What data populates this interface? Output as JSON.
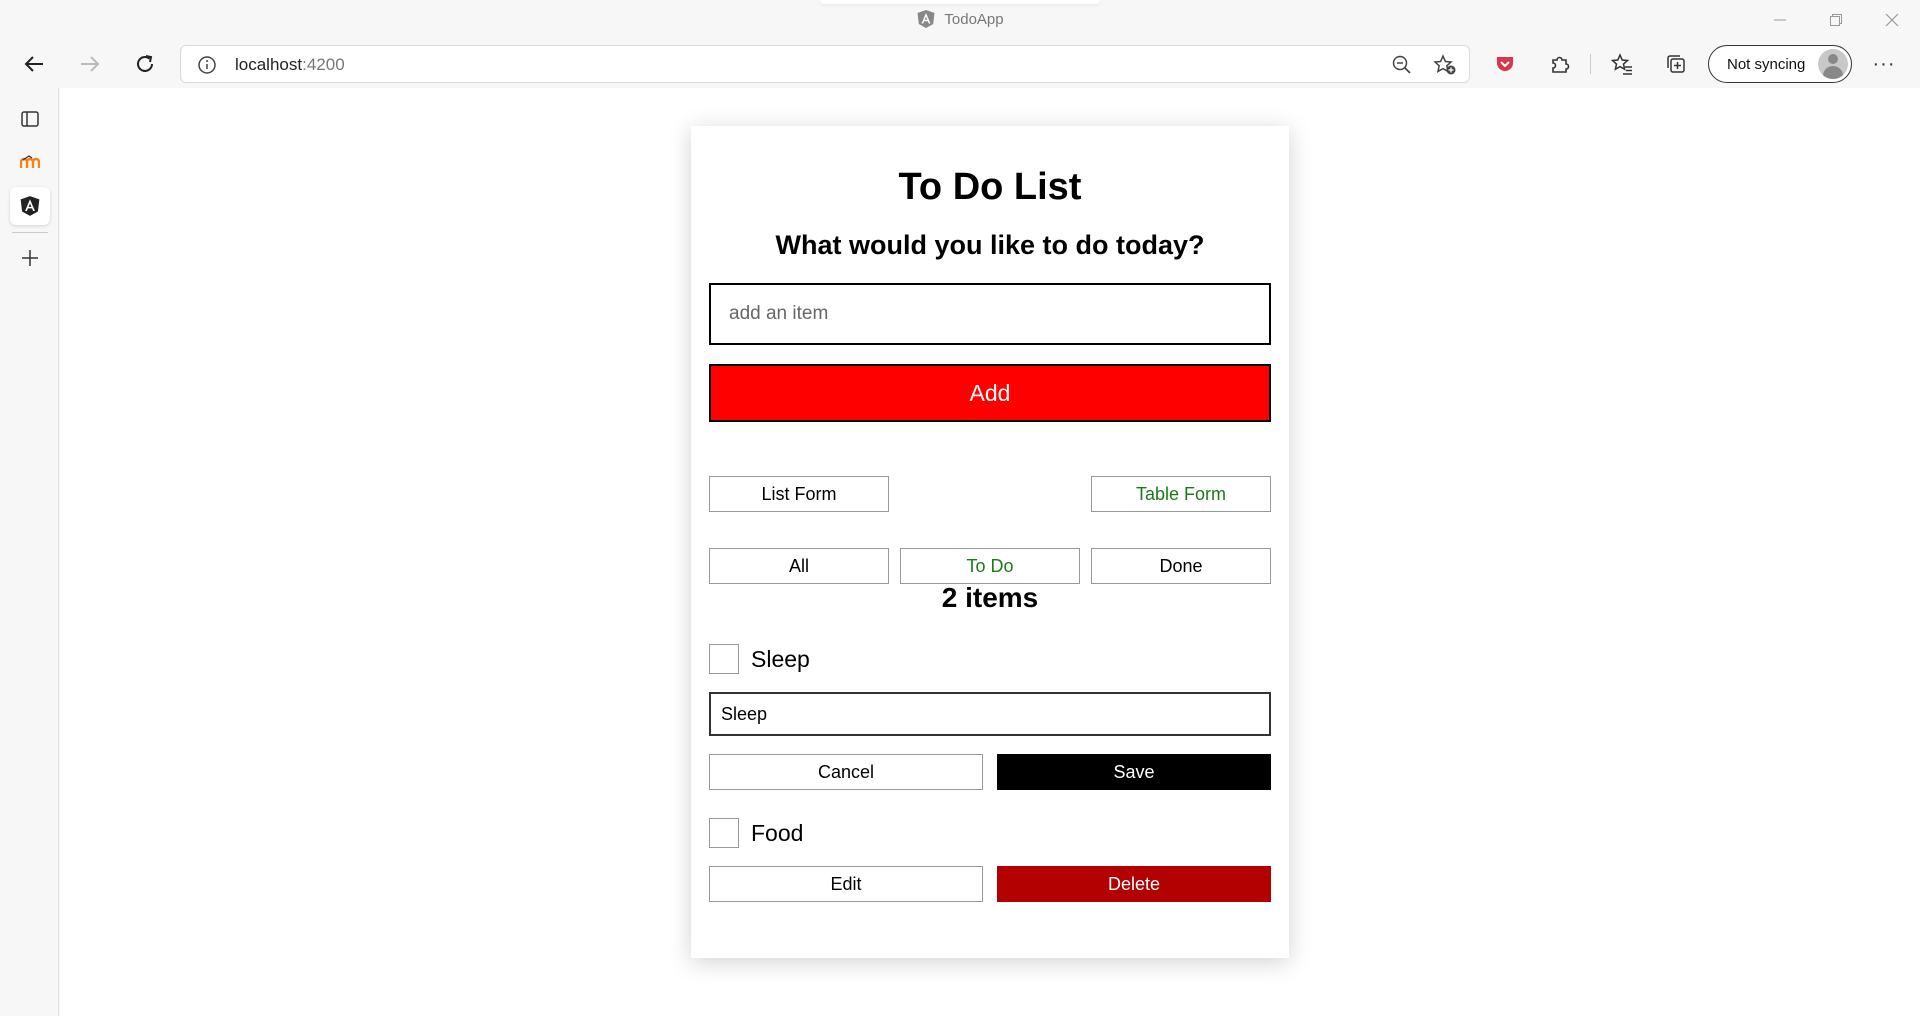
{
  "browser": {
    "tab_title": "TodoApp",
    "url_host": "localhost",
    "url_port": ":4200",
    "sync_label": "Not syncing"
  },
  "app": {
    "title": "To Do List",
    "subtitle": "What would you like to do today?",
    "add_placeholder": "add an item",
    "add_label": "Add",
    "view_buttons": {
      "list": "List Form",
      "table": "Table Form"
    },
    "filters": {
      "all": "All",
      "todo": "To Do",
      "done": "Done"
    },
    "count_label": "2 items",
    "items": [
      {
        "label": "Sleep",
        "edit_value": "Sleep",
        "cancel": "Cancel",
        "save": "Save"
      },
      {
        "label": "Food",
        "edit": "Edit",
        "delete": "Delete"
      }
    ]
  },
  "colors": {
    "add_button": "#ff0000",
    "active_green": "#1a7a1a",
    "save_button": "#000000",
    "delete_button": "#b30000"
  }
}
